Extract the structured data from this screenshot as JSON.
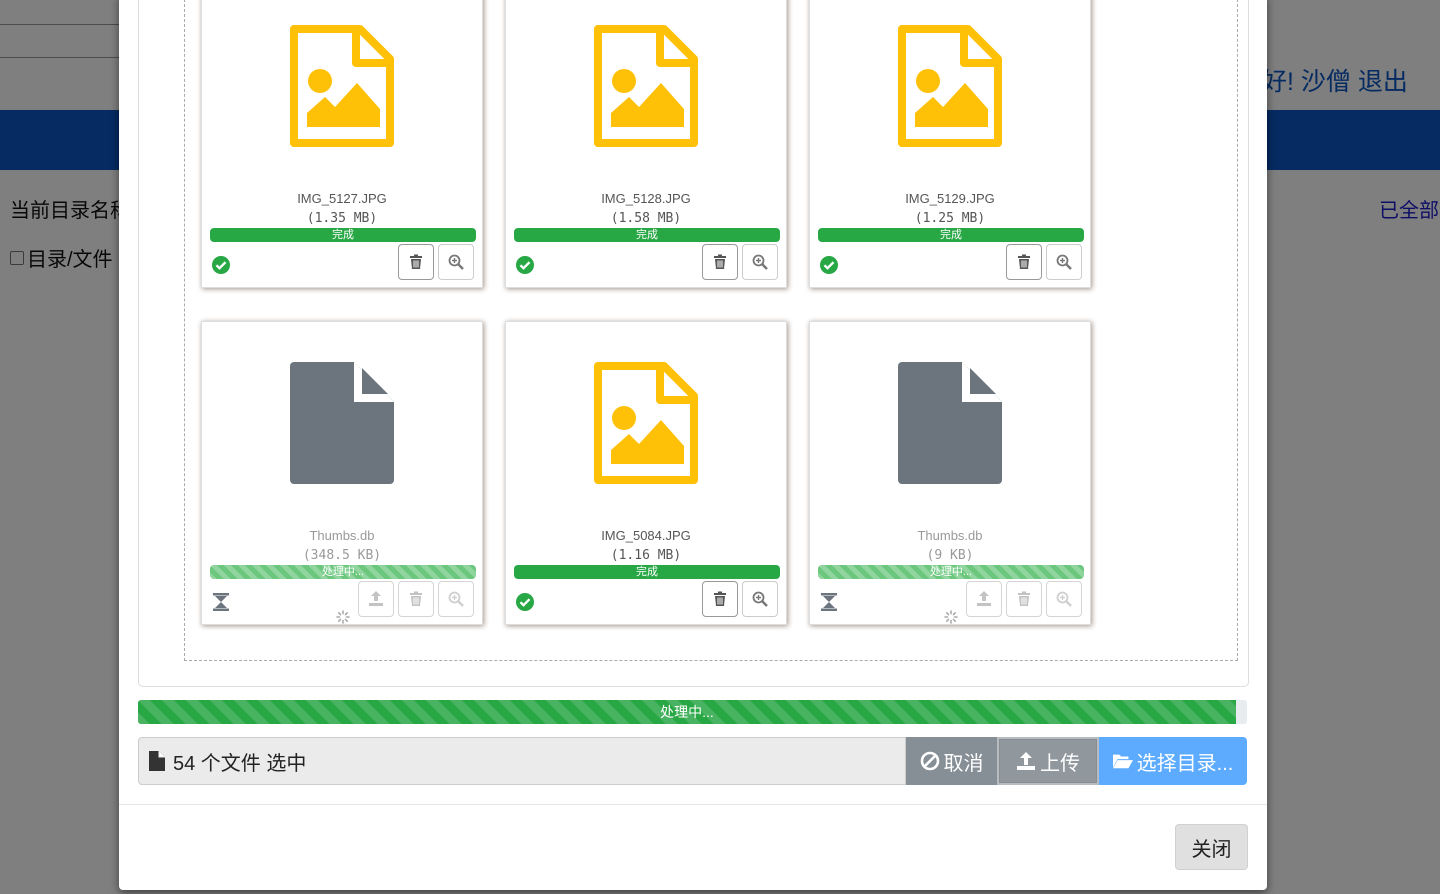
{
  "background": {
    "greeting": "好! 沙僧 退出",
    "current_dir_label": "当前目录名称",
    "select_all_label": "已全部",
    "checkbox_label": "目录/文件"
  },
  "files": [
    {
      "name": "IMG_5127.JPG",
      "size": "(1.35 MB)",
      "status": "完成",
      "state": "done",
      "type": "image"
    },
    {
      "name": "IMG_5128.JPG",
      "size": "(1.58 MB)",
      "status": "完成",
      "state": "done",
      "type": "image"
    },
    {
      "name": "IMG_5129.JPG",
      "size": "(1.25 MB)",
      "status": "完成",
      "state": "done",
      "type": "image"
    },
    {
      "name": "Thumbs.db",
      "size": "(348.5 KB)",
      "status": "处理中...",
      "state": "processing",
      "type": "file"
    },
    {
      "name": "IMG_5084.JPG",
      "size": "(1.16 MB)",
      "status": "完成",
      "state": "done",
      "type": "image"
    },
    {
      "name": "Thumbs.db",
      "size": "(9 KB)",
      "status": "处理中...",
      "state": "processing",
      "type": "file"
    }
  ],
  "main_progress": {
    "label": "处理中...",
    "percent": 99
  },
  "caption": {
    "text": "54 个文件 选中"
  },
  "buttons": {
    "cancel": "取消",
    "upload": "上传",
    "browse": "选择目录...",
    "close": "关闭"
  },
  "colors": {
    "image_icon": "#ffc107",
    "file_icon": "#6c757d",
    "success": "#28a745",
    "browse_button": "#5cabff"
  }
}
